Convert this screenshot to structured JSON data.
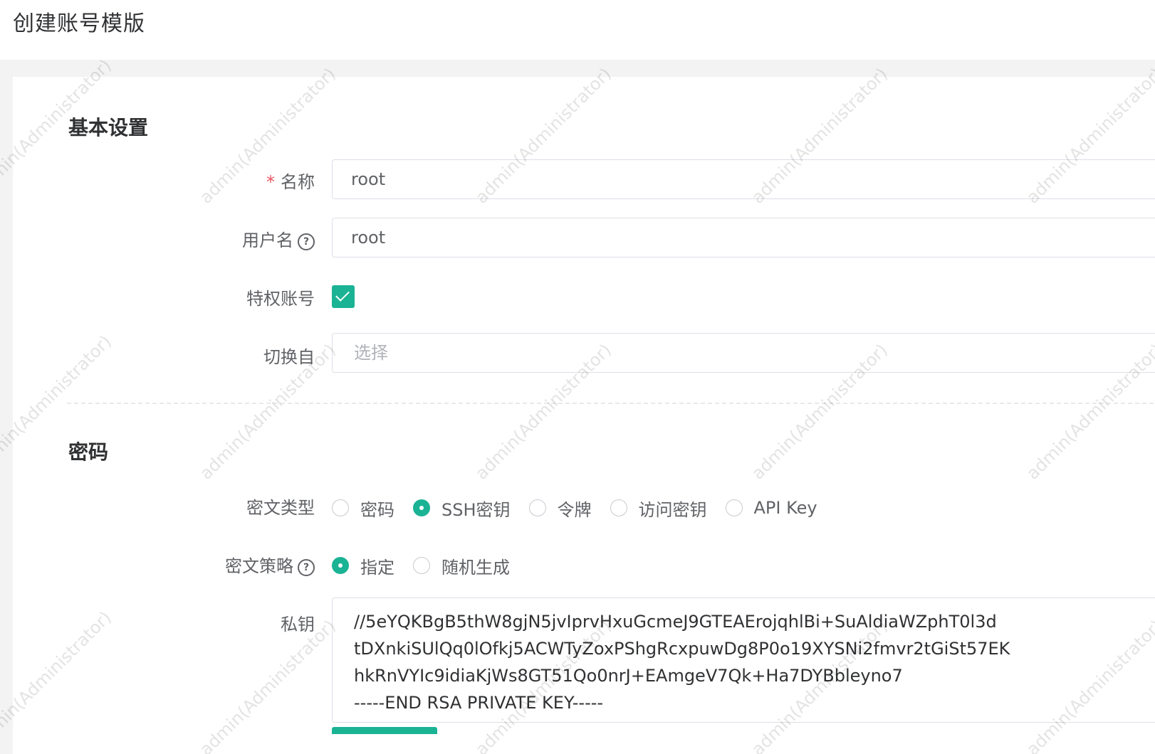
{
  "page": {
    "title": "创建账号模版"
  },
  "sections": {
    "basic": "基本设置",
    "secret": "密码"
  },
  "fields": {
    "name": {
      "label": "名称",
      "required_mark": "*",
      "value": "root"
    },
    "username": {
      "label": "用户名",
      "help_icon": "question-circle-icon",
      "value": "root"
    },
    "privileged": {
      "label": "特权账号",
      "checked": true
    },
    "su_from": {
      "label": "切换自",
      "placeholder": "选择"
    },
    "secret_type": {
      "label": "密文类型",
      "options": [
        "密码",
        "SSH密钥",
        "令牌",
        "访问密钥",
        "API Key"
      ],
      "selected": "SSH密钥"
    },
    "secret_strategy": {
      "label": "密文策略",
      "help_icon": "question-circle-icon",
      "options": [
        "指定",
        "随机生成"
      ],
      "selected": "指定"
    },
    "private_key": {
      "label": "私钥",
      "lines": [
        "//5eYQKBgB5thW8gjN5jvIprvHxuGcmeJ9GTEAErojqhlBi+SuAldiaWZphT0l3d",
        "tDXnkiSUlQq0lOfkj5ACWTyZoxPShgRcxpuwDg8P0o19XYSNi2fmvr2tGiSt57EK",
        "hkRnVYIc9idiaKjWs8GT51Qo0nrJ+EAmgeV7Qk+Ha7DYBbleyno7",
        "-----END RSA PRIVATE KEY-----"
      ]
    }
  },
  "watermark": "admin(Administrator)",
  "colors": {
    "accent": "#1ab394",
    "required": "#ed5565",
    "background": "#f3f3f4",
    "border": "#dcdfe6"
  }
}
